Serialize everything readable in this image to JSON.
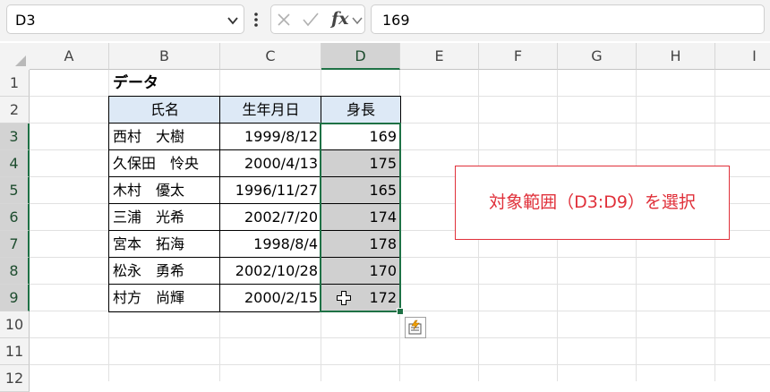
{
  "formula_bar": {
    "name_box": "D3",
    "formula": "169",
    "fx_label": "fx"
  },
  "columns": [
    "A",
    "B",
    "C",
    "D",
    "E",
    "F",
    "G",
    "H",
    "I"
  ],
  "rows": [
    "1",
    "2",
    "3",
    "4",
    "5",
    "6",
    "7",
    "8",
    "9",
    "10",
    "11",
    "12"
  ],
  "sheet": {
    "title": "データ",
    "headers": {
      "name": "氏名",
      "birth": "生年月日",
      "height": "身長"
    },
    "records": [
      {
        "name": "西村　大樹",
        "birth": "1999/8/12",
        "height": "169"
      },
      {
        "name": "久保田　怜央",
        "birth": "2000/4/13",
        "height": "175"
      },
      {
        "name": "木村　優太",
        "birth": "1996/11/27",
        "height": "165"
      },
      {
        "name": "三浦　光希",
        "birth": "2002/7/20",
        "height": "174"
      },
      {
        "name": "宮本　拓海",
        "birth": "1998/8/4",
        "height": "178"
      },
      {
        "name": "松永　勇希",
        "birth": "2002/10/28",
        "height": "170"
      },
      {
        "name": "村方　尚輝",
        "birth": "2000/2/15",
        "height": "172"
      }
    ]
  },
  "annotation": "対象範囲（D3:D9）を選択",
  "colors": {
    "selection_border": "#1e7145",
    "header_fill": "#dde9f6",
    "annotation_red": "#e0303a"
  }
}
